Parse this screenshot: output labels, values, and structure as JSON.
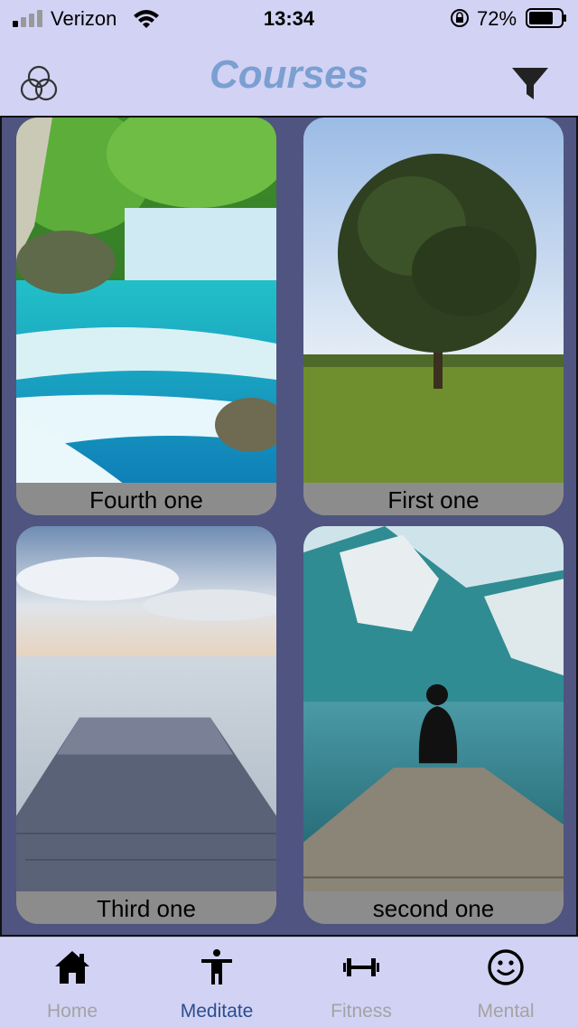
{
  "status_bar": {
    "carrier": "Verizon",
    "time": "13:34",
    "battery": "72%"
  },
  "header": {
    "title": "Courses",
    "left_icon": "circles-icon",
    "right_icon": "filter-icon"
  },
  "courses": [
    {
      "label": "Fourth one",
      "image": "waterfall"
    },
    {
      "label": "First one",
      "image": "tree-field"
    },
    {
      "label": "Third one",
      "image": "pier-lake"
    },
    {
      "label": "second one",
      "image": "person-mountain-lake"
    }
  ],
  "tabs": [
    {
      "label": "Home",
      "icon": "home-icon",
      "active": false
    },
    {
      "label": "Meditate",
      "icon": "person-icon",
      "active": true
    },
    {
      "label": "Fitness",
      "icon": "dumbbell-icon",
      "active": false
    },
    {
      "label": "Mental",
      "icon": "smile-icon",
      "active": false
    }
  ],
  "colors": {
    "background": "#d2d2f4",
    "content": "#4f5580",
    "title": "#7b9fd0",
    "active_tab": "#2a4f8f",
    "inactive_tab": "#a3a3a3"
  }
}
